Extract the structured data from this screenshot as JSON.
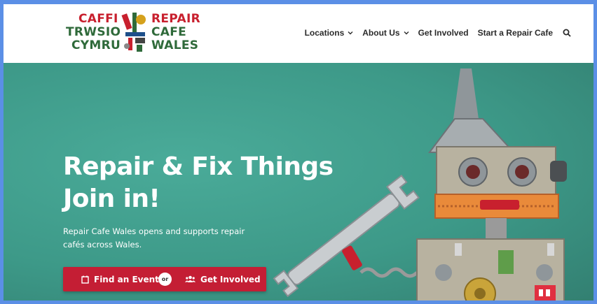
{
  "logo": {
    "welsh_line1": "CAFFI",
    "welsh_line2": "TRWSIO",
    "welsh_line3": "CYMRU",
    "english_line1": "REPAIR",
    "english_line2": "CAFE",
    "english_line3": "WALES"
  },
  "nav": {
    "items": [
      {
        "label": "Locations",
        "dropdown": true
      },
      {
        "label": "About Us",
        "dropdown": true
      },
      {
        "label": "Get Involved",
        "dropdown": false
      },
      {
        "label": "Start a Repair Cafe",
        "dropdown": false
      }
    ],
    "search_icon": "search-icon"
  },
  "hero": {
    "title_line1": "Repair & Fix Things",
    "title_line2": "Join in!",
    "subtitle": "Repair Cafe Wales opens and supports repair cafés across Wales.",
    "cta_primary": "Find an Event",
    "cta_or": "or",
    "cta_secondary": "Get Involved"
  },
  "colors": {
    "accent_red": "#c41e34",
    "logo_green": "#2f6a3a",
    "hero_teal": "#3f9d8c",
    "frame_blue": "#5b8fe6"
  }
}
